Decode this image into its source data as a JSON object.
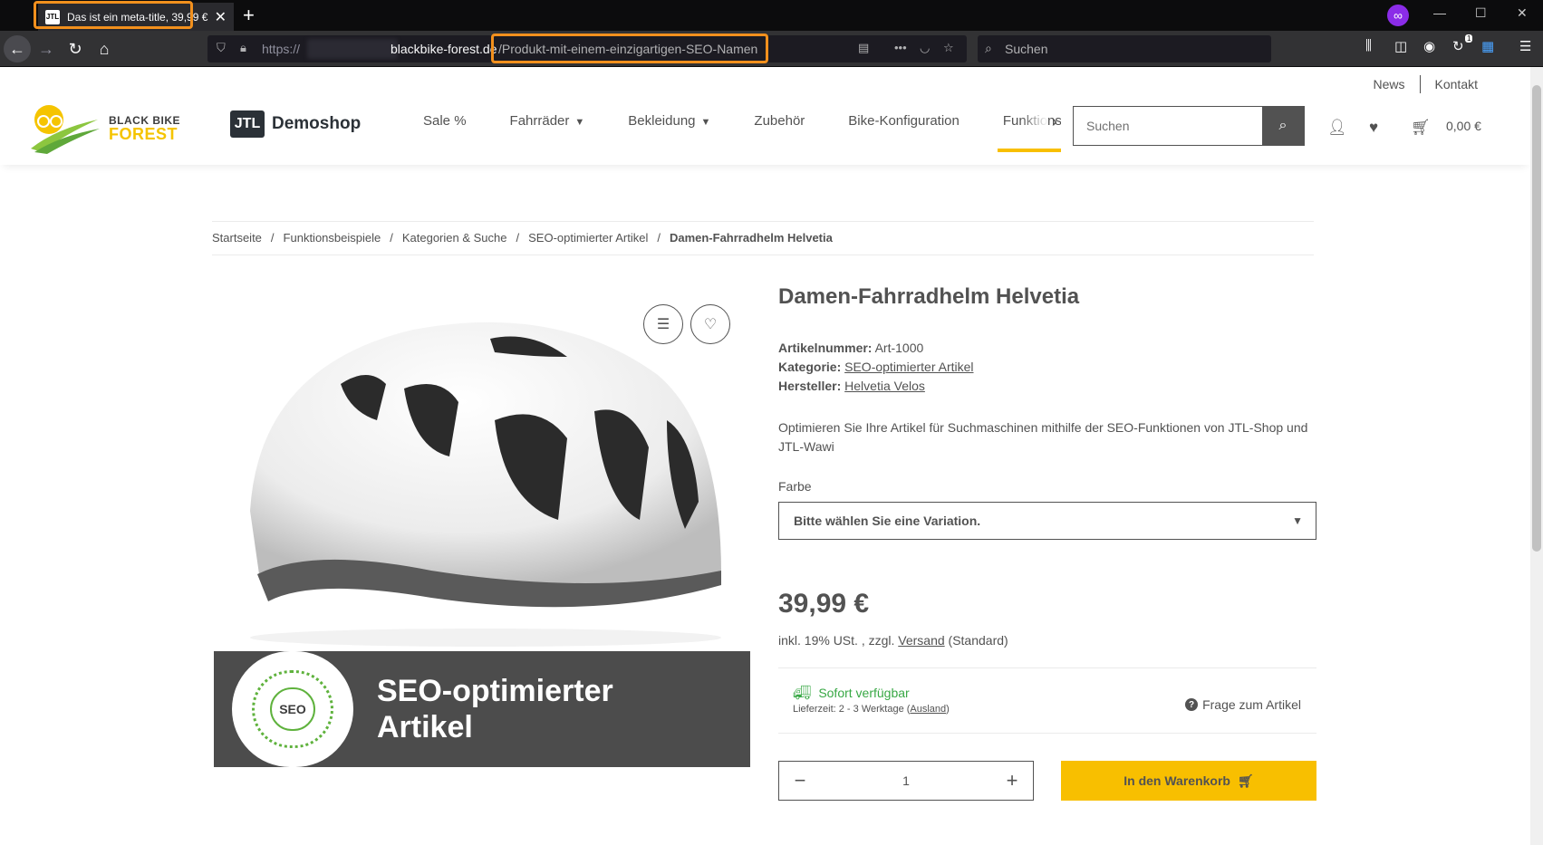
{
  "browser": {
    "tab_title": "Das ist ein meta-title, 39,99 €",
    "tab_favicon": "JTL",
    "url_protocol": "https://",
    "url_host": "blackbike-forest.de",
    "url_path": "/Produkt-mit-einem-einzigartigen-SEO-Namen",
    "search_placeholder": "Suchen",
    "downloads_badge": "1",
    "highlight_color": "#f2901d"
  },
  "topnav": {
    "news": "News",
    "contact": "Kontakt"
  },
  "header": {
    "brand_line1": "BLACK BIKE",
    "brand_line2": "FOREST",
    "jtl_mark": "JTL",
    "jtl_name": "Demoshop",
    "nav": [
      {
        "label": "Sale %"
      },
      {
        "label": "Fahrräder"
      },
      {
        "label": "Bekleidung"
      },
      {
        "label": "Zubehör"
      },
      {
        "label": "Bike-Konfiguration"
      },
      {
        "label": "Funktionsbeispiele"
      }
    ],
    "search_placeholder": "Suchen",
    "cart_total": "0,00 €",
    "accent_color": "#f8bf00"
  },
  "breadcrumb": {
    "items": [
      "Startseite",
      "Funktionsbeispiele",
      "Kategorien & Suche",
      "SEO-optimierter Artikel"
    ],
    "current": "Damen-Fahrradhelm Helvetia"
  },
  "gallery": {
    "banner_line1": "SEO-optimierter",
    "banner_line2": "Artikel",
    "badge_text": "SEO"
  },
  "product": {
    "title": "Damen-Fahrradhelm Helvetia",
    "sku_label": "Artikelnummer:",
    "sku_value": "Art-1000",
    "category_label": "Kategorie:",
    "category_value": "SEO-optimierter Artikel",
    "manufacturer_label": "Hersteller:",
    "manufacturer_value": "Helvetia Velos",
    "description": "Optimieren Sie Ihre Artikel für Suchmaschinen mithilfe der SEO-Funktionen von JTL-Shop und JTL-Wawi",
    "variation_label": "Farbe",
    "variation_placeholder": "Bitte wählen Sie eine Variation.",
    "price": "39,99 €",
    "tax_prefix": "inkl. 19% USt. , zzgl.",
    "shipping_link": "Versand",
    "tax_suffix": "(Standard)",
    "availability": "Sofort verfügbar",
    "delivery_prefix": "Lieferzeit: 2 - 3 Werktage (",
    "delivery_link": "Ausland",
    "delivery_suffix": ")",
    "question": "Frage zum Artikel",
    "quantity": "1",
    "add_to_cart": "In den Warenkorb",
    "availability_color": "#38a845"
  }
}
